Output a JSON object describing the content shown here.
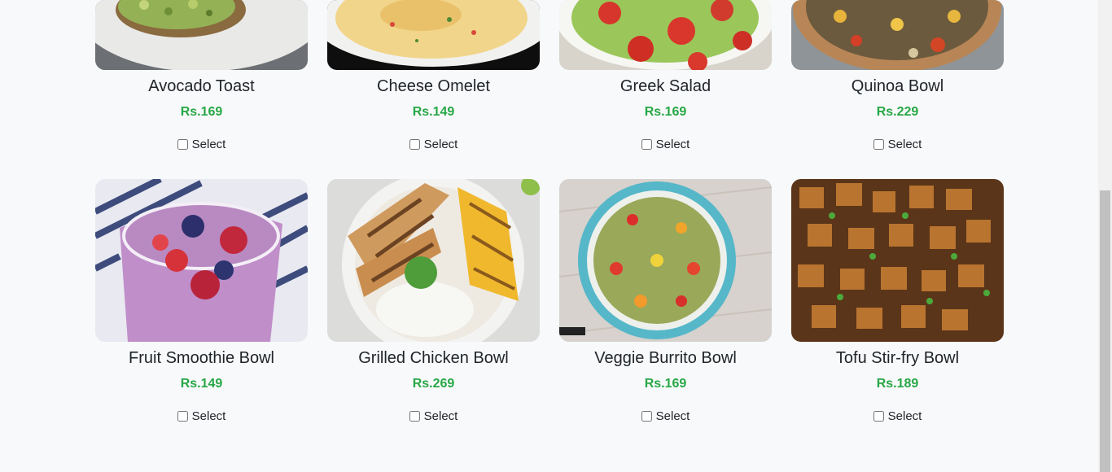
{
  "select_label": "Select",
  "accent_color": "#28a745",
  "items": [
    {
      "name": "Avocado Toast",
      "price": "Rs.169",
      "image_icon": "avocado-toast-photo"
    },
    {
      "name": "Cheese Omelet",
      "price": "Rs.149",
      "image_icon": "cheese-omelet-photo"
    },
    {
      "name": "Greek Salad",
      "price": "Rs.169",
      "image_icon": "greek-salad-photo"
    },
    {
      "name": "Quinoa Bowl",
      "price": "Rs.229",
      "image_icon": "quinoa-bowl-photo"
    },
    {
      "name": "Fruit Smoothie Bowl",
      "price": "Rs.149",
      "image_icon": "fruit-smoothie-photo"
    },
    {
      "name": "Grilled Chicken Bowl",
      "price": "Rs.269",
      "image_icon": "grilled-chicken-photo"
    },
    {
      "name": "Veggie Burrito Bowl",
      "price": "Rs.169",
      "image_icon": "veggie-bowl-photo"
    },
    {
      "name": "Tofu Stir-fry Bowl",
      "price": "Rs.189",
      "image_icon": "tofu-stir-fry-photo"
    }
  ]
}
